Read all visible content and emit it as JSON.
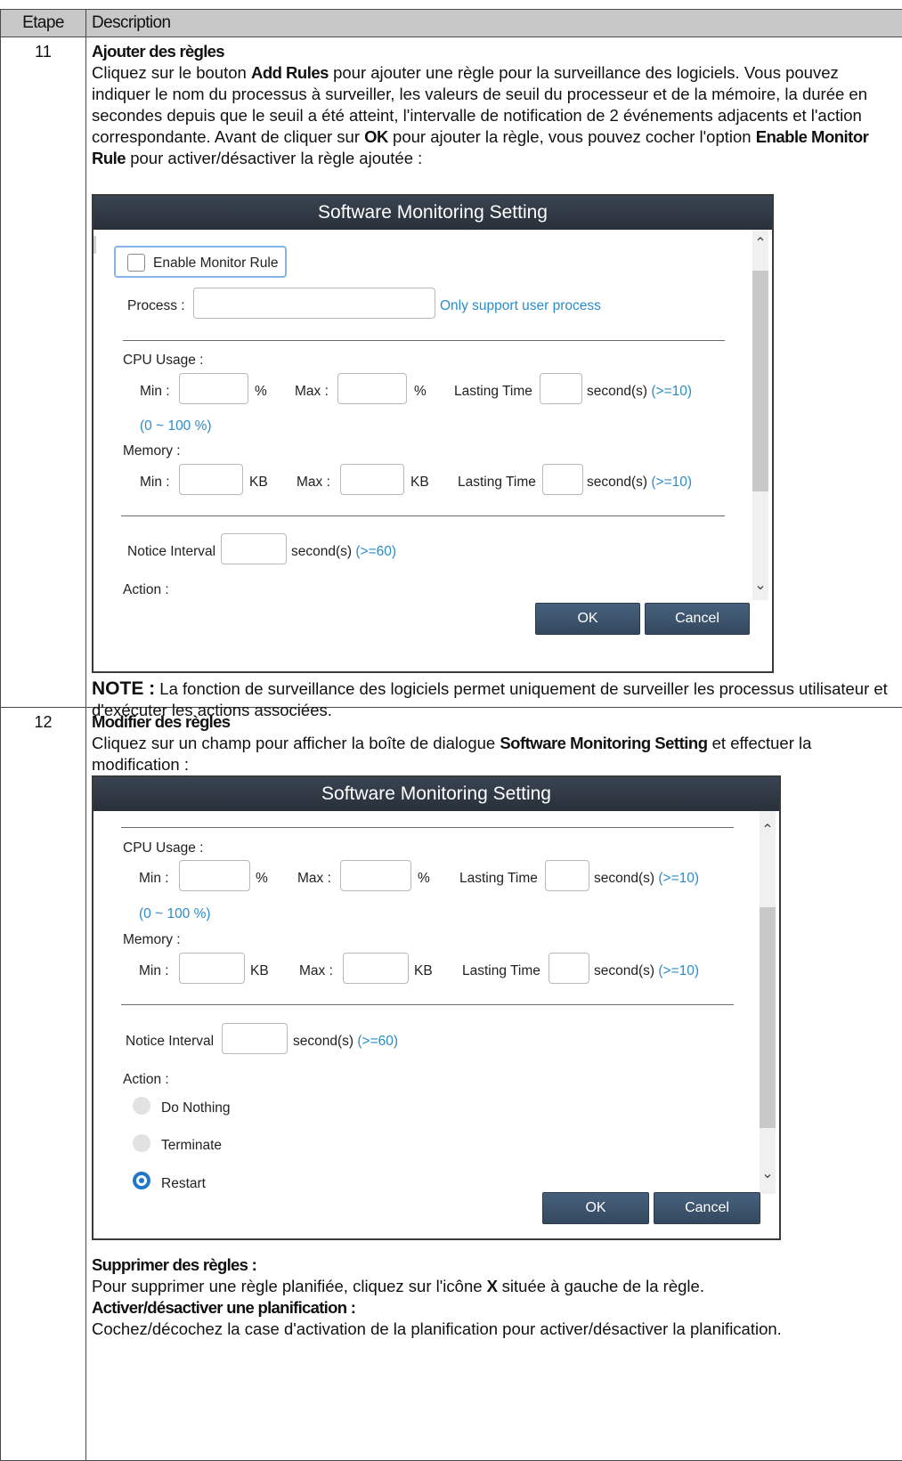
{
  "table": {
    "header_step": "Etape",
    "header_desc": "Description"
  },
  "step11": {
    "number": "11",
    "title": "Ajouter des règles",
    "text_1": "Cliquez sur le bouton ",
    "add_rules": "Add Rules",
    "text_2": " pour ajouter une règle pour la surveillance des logiciels. Vous pouvez indiquer le nom du processus à surveiller, les valeurs de seuil du processeur et de la mémoire, la durée en secondes depuis que le seuil a été atteint, l'intervalle de notification de 2 événements adjacents et l'action correspondante. Avant de cliquer sur ",
    "ok": "OK",
    "text_3": " pour ajouter la règle, vous pouvez cocher l'option ",
    "enable_rule": "Enable Monitor Rule",
    "text_4": " pour activer/désactiver la règle ajoutée :",
    "note_label": "NOTE :",
    "note_text": " La fonction de surveillance des logiciels permet uniquement de surveiller les processus utilisateur et d'exécuter les actions associées.",
    "dialog": {
      "title": "Software Monitoring Setting",
      "enable_label": "Enable Monitor Rule",
      "process_label": "Process :",
      "process_hint": "Only support user process",
      "cpu_label": "CPU Usage :",
      "min": "Min :",
      "max": "Max :",
      "pct": "%",
      "lasting": "Lasting Time",
      "seconds": "second(s)",
      "gte10": "(>=10)",
      "range": "(0 ~ 100 %)",
      "memory_label": "Memory :",
      "kb": "KB",
      "notice": "Notice Interval",
      "gte60": "(>=60)",
      "action": "Action :",
      "ok": "OK",
      "cancel": "Cancel"
    }
  },
  "step12": {
    "number": "12",
    "title": "Modifier des règles",
    "text_1": "Cliquez sur un champ pour afficher la boîte de dialogue ",
    "dialog_name": "Software Monitoring Setting",
    "text_2": " et effectuer la modification :",
    "delete_title": "Supprimer des règles :",
    "delete_text_1": "Pour supprimer une règle planifiée, cliquez sur l'icône ",
    "x_icon": "X",
    "delete_text_2": " située à gauche de la règle.",
    "toggle_title": "Activer/désactiver une planification :",
    "toggle_text": "Cochez/décochez la case d'activation de la planification pour activer/désactiver la planification.",
    "dialog": {
      "title": "Software Monitoring Setting",
      "cpu_label": "CPU Usage :",
      "min": "Min :",
      "max": "Max :",
      "pct": "%",
      "lasting": "Lasting Time",
      "seconds": "second(s)",
      "gte10": "(>=10)",
      "range": "(0 ~ 100 %)",
      "memory_label": "Memory :",
      "kb": "KB",
      "notice": "Notice Interval",
      "gte60": "(>=60)",
      "action": "Action :",
      "opt_nothing": "Do Nothing",
      "opt_terminate": "Terminate",
      "opt_restart": "Restart",
      "ok": "OK",
      "cancel": "Cancel"
    }
  }
}
